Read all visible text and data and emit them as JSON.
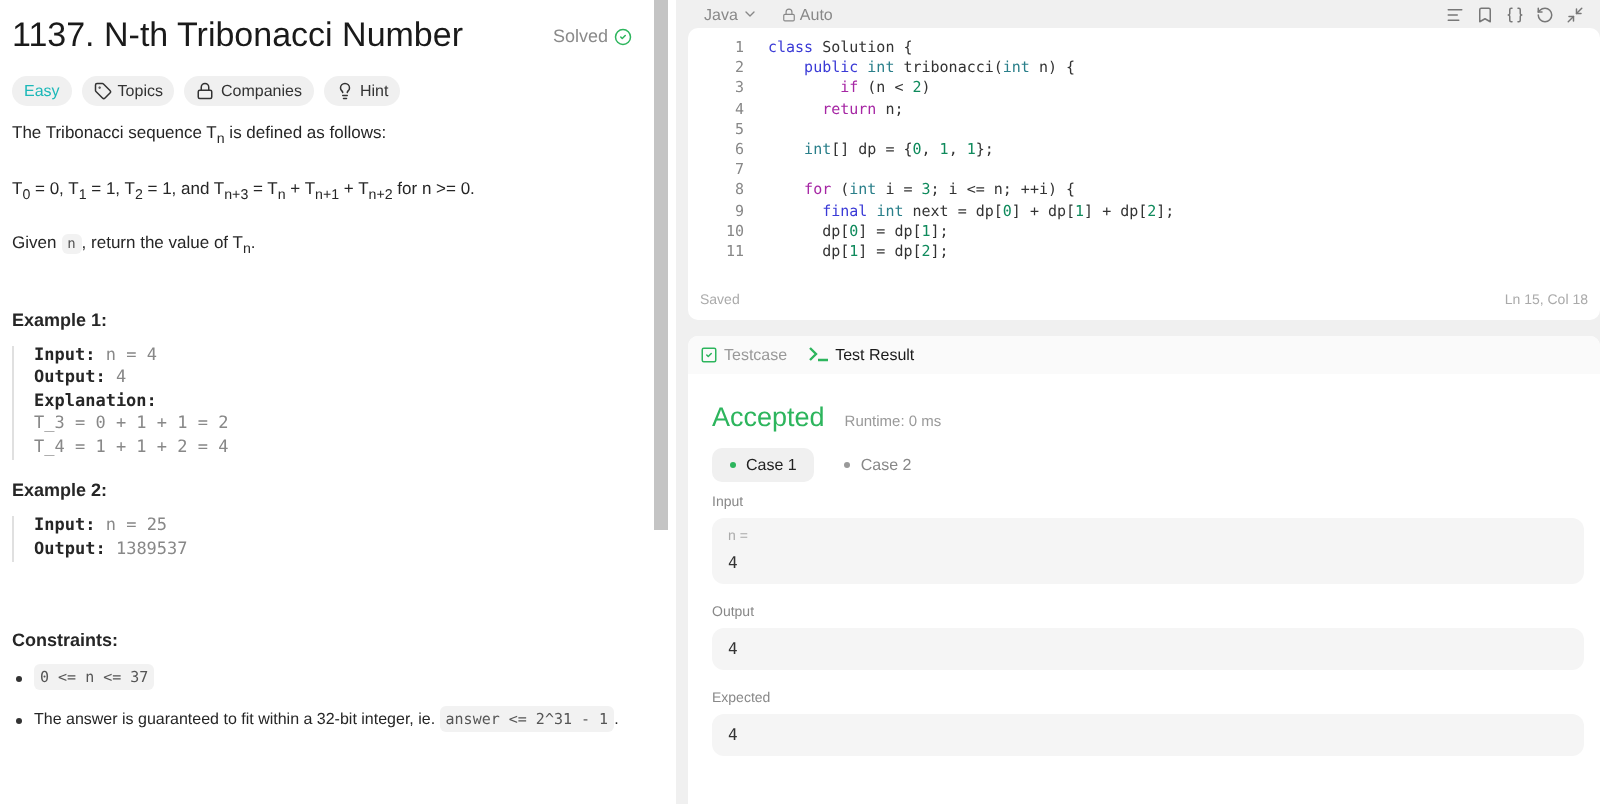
{
  "problem": {
    "title": "1137. N-th Tribonacci Number",
    "status": "Solved",
    "tags": [
      {
        "kind": "difficulty",
        "label": "Easy"
      },
      {
        "kind": "topics",
        "label": "Topics"
      },
      {
        "kind": "companies",
        "label": "Companies"
      },
      {
        "kind": "hint",
        "label": "Hint"
      }
    ],
    "paragraphs": [
      [
        {
          "kind": "text",
          "text": "The Tribonacci sequence T$_{n}$ is defined as follows:"
        }
      ],
      [
        {
          "kind": "text",
          "text": "T$_{0}$ = 0, T$_{1}$ = 1, T$_{2}$ = 1, and T$_{n+3}$ = T$_{n}$ + T$_{n+1}$ + T$_{n+2}$ for n >= 0."
        }
      ],
      [
        {
          "kind": "text",
          "text": "Given "
        },
        {
          "kind": "code",
          "text": "n"
        },
        {
          "kind": "text",
          "text": ", return the value of T$_{n}$."
        }
      ]
    ],
    "examples": [
      {
        "heading": "Example 1:",
        "lines": [
          {
            "label": "Input:",
            "value": "n = 4"
          },
          {
            "label": "Output:",
            "value": "4"
          },
          {
            "label": "Explanation:"
          },
          {
            "value": "T_3 = 0 + 1 + 1 = 2"
          },
          {
            "value": "T_4 = 1 + 1 + 2 = 4"
          }
        ]
      },
      {
        "heading": "Example 2:",
        "lines": [
          {
            "label": "Input:",
            "value": "n = 25"
          },
          {
            "label": "Output:",
            "value": "1389537"
          }
        ]
      }
    ],
    "constraints_heading": "Constraints:",
    "constraints": [
      [
        {
          "kind": "code",
          "text": "0 <= n <= 37"
        }
      ],
      [
        {
          "kind": "text",
          "text": "The answer is guaranteed to fit within a 32-bit integer, ie. "
        },
        {
          "kind": "code",
          "text": "answer <= 2^31 - 1"
        },
        {
          "kind": "text",
          "text": "."
        }
      ]
    ]
  },
  "editor": {
    "language": "Java",
    "mode": "Auto",
    "lines": [
      {
        "num": "1",
        "tokens": [
          {
            "kind": "keyword",
            "text": "class "
          },
          {
            "kind": "plain",
            "text": "Solution {"
          }
        ]
      },
      {
        "num": "2",
        "tokens": [
          {
            "kind": "keyword",
            "text": "    public "
          },
          {
            "kind": "type",
            "text": "int "
          },
          {
            "kind": "plain",
            "text": "tribonacci("
          },
          {
            "kind": "type",
            "text": "int "
          },
          {
            "kind": "plain",
            "text": "n) {"
          }
        ]
      },
      {
        "num": "3",
        "tokens": [
          {
            "kind": "control",
            "text": "        if "
          },
          {
            "kind": "plain",
            "text": "(n < "
          },
          {
            "kind": "number",
            "text": "2"
          },
          {
            "kind": "plain",
            "text": ")"
          }
        ]
      },
      {
        "num": "4",
        "tokens": [
          {
            "kind": "control",
            "text": "      return "
          },
          {
            "kind": "plain",
            "text": "n;"
          }
        ]
      },
      {
        "num": "5"
      },
      {
        "num": "6",
        "tokens": [
          {
            "kind": "type",
            "text": "    int"
          },
          {
            "kind": "plain",
            "text": "[] dp = {"
          },
          {
            "kind": "number",
            "text": "0"
          },
          {
            "kind": "plain",
            "text": ", "
          },
          {
            "kind": "number",
            "text": "1"
          },
          {
            "kind": "plain",
            "text": ", "
          },
          {
            "kind": "number",
            "text": "1"
          },
          {
            "kind": "plain",
            "text": "};"
          }
        ]
      },
      {
        "num": "7"
      },
      {
        "num": "8",
        "tokens": [
          {
            "kind": "control",
            "text": "    for "
          },
          {
            "kind": "plain",
            "text": "("
          },
          {
            "kind": "type",
            "text": "int "
          },
          {
            "kind": "plain",
            "text": "i = "
          },
          {
            "kind": "number",
            "text": "3"
          },
          {
            "kind": "plain",
            "text": "; i <= n; ++i) {"
          }
        ]
      },
      {
        "num": "9",
        "tokens": [
          {
            "kind": "keyword",
            "text": "      final "
          },
          {
            "kind": "type",
            "text": "int "
          },
          {
            "kind": "plain",
            "text": "next = dp["
          },
          {
            "kind": "number",
            "text": "0"
          },
          {
            "kind": "plain",
            "text": "] + dp["
          },
          {
            "kind": "number",
            "text": "1"
          },
          {
            "kind": "plain",
            "text": "] + dp["
          },
          {
            "kind": "number",
            "text": "2"
          },
          {
            "kind": "plain",
            "text": "];"
          }
        ]
      },
      {
        "num": "10",
        "tokens": [
          {
            "kind": "plain",
            "text": "      dp["
          },
          {
            "kind": "number",
            "text": "0"
          },
          {
            "kind": "plain",
            "text": "] = dp["
          },
          {
            "kind": "number",
            "text": "1"
          },
          {
            "kind": "plain",
            "text": "];"
          }
        ]
      },
      {
        "num": "11",
        "tokens": [
          {
            "kind": "plain",
            "text": "      dp["
          },
          {
            "kind": "number",
            "text": "1"
          },
          {
            "kind": "plain",
            "text": "] = dp["
          },
          {
            "kind": "number",
            "text": "2"
          },
          {
            "kind": "plain",
            "text": "];"
          }
        ]
      }
    ],
    "saved": "Saved",
    "cursor": "Ln 15, Col 18"
  },
  "results": {
    "tabs": [
      {
        "kind": "testcase",
        "label": "Testcase",
        "selected": false
      },
      {
        "kind": "result",
        "label": "Test Result",
        "selected": true
      }
    ],
    "verdict": "Accepted",
    "runtime": "Runtime: 0 ms",
    "cases": [
      {
        "label": "Case 1",
        "selected": true
      },
      {
        "label": "Case 2",
        "selected": false
      }
    ],
    "sections": [
      {
        "label": "Input",
        "var": "n =",
        "value": "4"
      },
      {
        "label": "Output",
        "value": "4"
      },
      {
        "label": "Expected",
        "value": "4"
      }
    ]
  }
}
